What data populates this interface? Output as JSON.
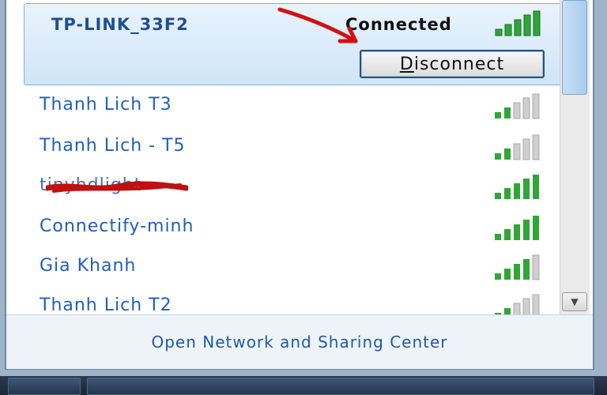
{
  "connected_network": {
    "name": "TP-LINK_33F2",
    "status": "Connected",
    "button_label_first": "D",
    "button_label_rest": "isconnect",
    "signal_bars": 5,
    "signal_icon": "wifi-signal-icon"
  },
  "networks": [
    {
      "name": "Thanh Lich T3",
      "signal_bars": 2
    },
    {
      "name": "Thanh Lich - T5",
      "signal_bars": 2
    },
    {
      "name": "tinyhdlight",
      "signal_bars": 5,
      "redacted": true
    },
    {
      "name": "Connectify-minh",
      "signal_bars": 5
    },
    {
      "name": "Gia Khanh",
      "signal_bars": 4
    },
    {
      "name": "Thanh Lich T2",
      "signal_bars": 2
    }
  ],
  "footer": {
    "link_label": "Open Network and Sharing Center"
  },
  "colors": {
    "signal_active": "#2fa636",
    "signal_inactive": "#cfcfcf",
    "annotation": "#d11212",
    "link": "#1e5aa8"
  }
}
